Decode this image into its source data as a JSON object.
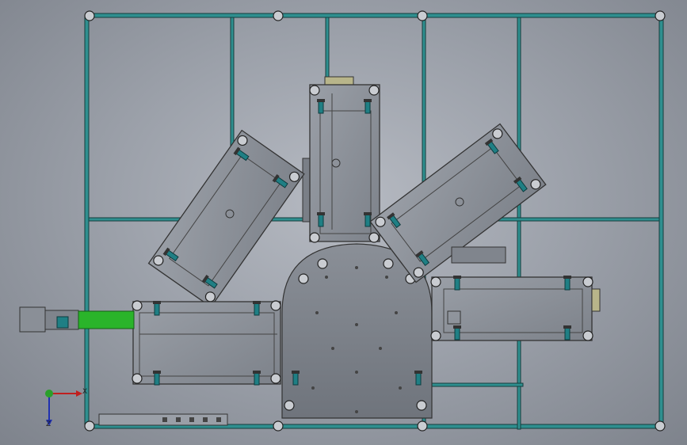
{
  "view": {
    "background": "#9da2ab",
    "frame_color": "#2f8f8f",
    "frame_edge": "#1a5050",
    "plate_color": "#7f848c",
    "module_color": "#8d929a",
    "module_dark": "#5e636b",
    "bolt_color": "#1f7f84",
    "accent_green": "#2ab42a"
  },
  "triad": {
    "x_label": "X",
    "z_label": "Z",
    "x_color": "#c0201f",
    "y_color": "#2aa02a",
    "z_color": "#2030b0"
  }
}
